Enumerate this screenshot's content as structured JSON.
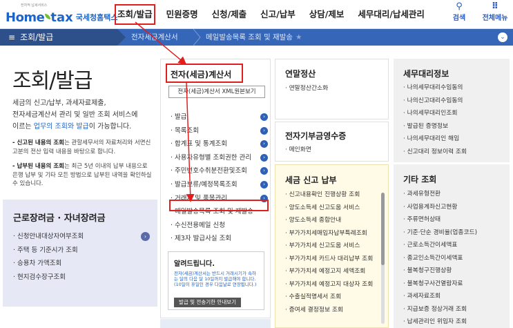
{
  "header": {
    "logo_small": "전자적 납세서비스",
    "logo_home": "Home",
    "logo_tax": "tax",
    "logo_nts": "국세청홈택스",
    "gnb": [
      "조회/발급",
      "민원증명",
      "신청/제출",
      "신고/납부",
      "상담/제보",
      "세무대리/납세관리"
    ],
    "util": [
      {
        "icon": "search-icon",
        "glyph": "⚲",
        "label": "검색"
      },
      {
        "icon": "grid-menu-icon",
        "glyph": "⠿",
        "label": "전체메뉴"
      }
    ]
  },
  "breadcrumb": {
    "menu_label": "조회/발급",
    "level2": "전자세금계산서",
    "level3": "메일발송목록 조회 및 재발송",
    "star": "★",
    "dropdown": "⌄"
  },
  "left": {
    "page_title": "조회/발급",
    "intro_a": "세금의 신고/납부, 과세자료제출,",
    "intro_b": "전자세금계산서 관리 및 일반 조회 서비스에",
    "intro_c1": "이르는 ",
    "intro_link": "업무의 조회와 발급",
    "intro_c2": "이 가능합니다.",
    "note1_bold": "- 신고된 내용의 조회",
    "note1_text": "는 관할세무서의 자료처리와 서면신고분의 전산 입력 내용을 바탕으로 합니다.",
    "note2_bold": "- 납부된 내용의 조회",
    "note2_text": "는 최근 5년 이내의 납부 내용으로 은행 납부 및 기타 모든 방법으로 납부된 내역을 확인하실 수 있습니다.",
    "box_title": "근로장려금 · 자녀장려금",
    "box_items": [
      "· 신청안내대상자여부조회",
      "· 주택 등 기준시가 조회",
      "· 승용차 가액조회",
      "· 현지검수장구조회"
    ],
    "box_go": "›"
  },
  "col2": {
    "title": "전자(세금)계산서",
    "viewer_btn": "전자(세금)계산서 XML원본보기",
    "items": [
      {
        "label": "· 발급",
        "go": true
      },
      {
        "label": "· 목록조회",
        "go": true
      },
      {
        "label": "· 합계표 및 통계조회",
        "go": true
      },
      {
        "label": "· 사용자유형별 조회권한 관리",
        "go": true
      },
      {
        "label": "· 주민번호수취분전환및조회",
        "go": true
      },
      {
        "label": "· 발급보류/예정목록조회",
        "go": true
      },
      {
        "label": "· 거래처 및 품목관리",
        "go": true
      },
      {
        "label": "· 메일발송목록 조회 및 재발송",
        "go": false
      },
      {
        "label": "· 수신전용메일 신청",
        "go": false
      },
      {
        "label": "· 제3자 발급사실 조회",
        "go": false
      }
    ],
    "notice_title": "알려드립니다.",
    "notice_text": "전자(세금)계산서는 반드시 거래시기가 속하는 달의 다음 달 10일까지 발급해야 합니다. (10일이 휴일인 경우 다음날로 연장됩니다.)",
    "notice_btn": "발급 및 전송기한 안내보기"
  },
  "col3": {
    "a_title": "연말정산",
    "a_items": [
      "· 연말정산간소화"
    ],
    "b_title": "전자기부금영수증",
    "b_items": [
      "· 메인화면"
    ],
    "c_title": "세금 신고 납부",
    "c_items": [
      "· 신고내용확인 진행상황 조회",
      "· 양도소득세 신고도움 서비스",
      "· 양도소득세 종합안내",
      "· 부가가치세매입자납부특례조회",
      "· 부가가치세 신고도움 서비스",
      "· 부가가치세 카드사 대리납부 조회",
      "· 부가가치세 예정고지 세액조회",
      "· 부가가치세 예정고지 대상자 조회",
      "· 수출실적명세서 조회",
      "· 증여세 결정정보 조회"
    ]
  },
  "col4": {
    "a_title": "세무대리정보",
    "a_items": [
      "· 나의세무대리수임동의",
      "· 나의신고대리수임동의",
      "· 나의세무대리인조회",
      "· 발급된 증명정보",
      "· 나의세무대리인 해임",
      "· 신고대리 정보이력 조회"
    ],
    "b_title": "기타 조회",
    "b_items": [
      "· 과세유형전환",
      "· 사업용계좌신고현황",
      "· 주류면허상태",
      "· 기준·단순 경비율(업종코드)",
      "· 근로소득간이세액표",
      "· 종교인소득간이세액표",
      "· 불복청구진행상황",
      "· 불복청구사건열람자료",
      "· 과세자료조회",
      "· 지급보증 정상거래 조회",
      "· 납세관리인 위임자 조회"
    ]
  },
  "colors": {
    "brand": "#1e64c8",
    "nav_bar": "#3566b8",
    "highlight": "#e01e1e"
  }
}
